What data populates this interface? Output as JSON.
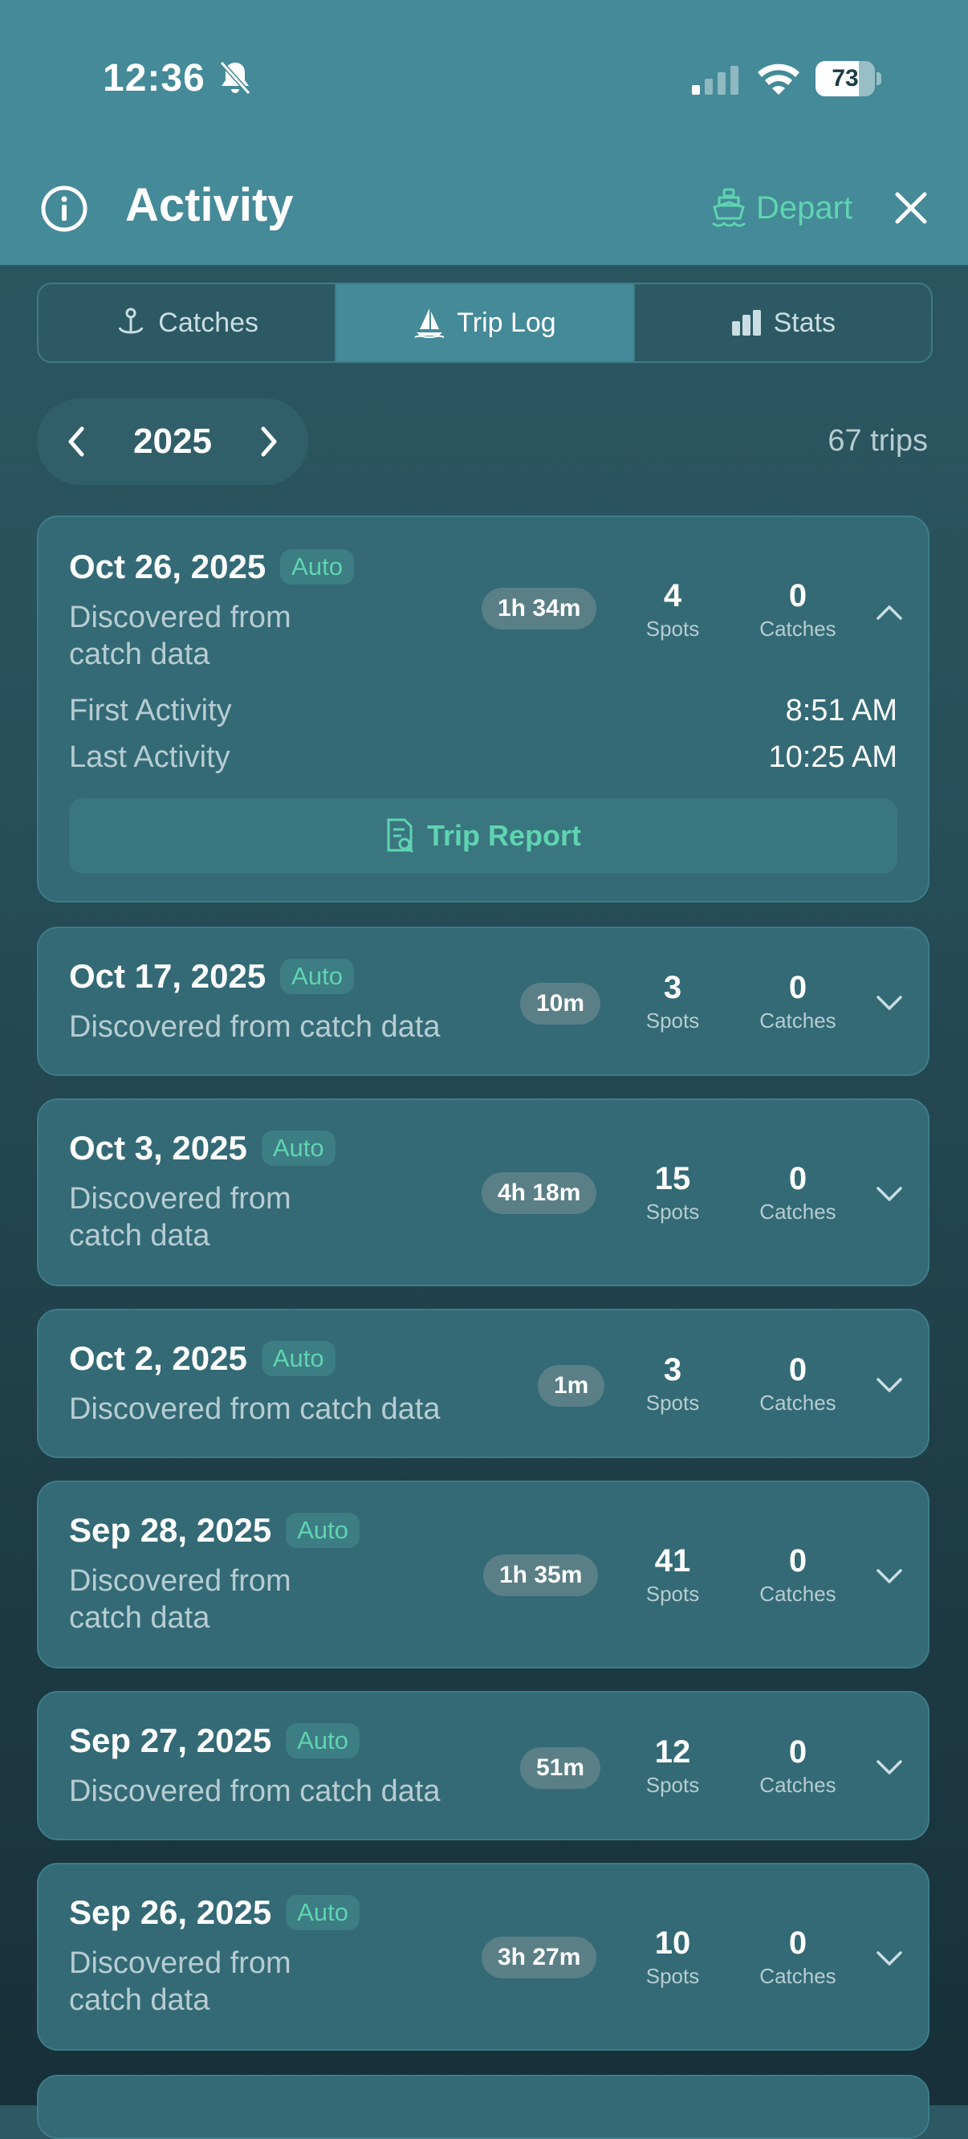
{
  "status_bar": {
    "time": "12:36",
    "battery": "73",
    "battery_level": 0.73
  },
  "header": {
    "title": "Activity",
    "depart_label": "Depart"
  },
  "tabs": [
    {
      "label": "Catches",
      "icon": "anchor-pin-icon"
    },
    {
      "label": "Trip Log",
      "icon": "sailboat-icon"
    },
    {
      "label": "Stats",
      "icon": "bar-chart-icon"
    }
  ],
  "active_tab": "Trip Log",
  "year_picker": {
    "year": "2025"
  },
  "trip_count": "67 trips",
  "labels": {
    "spots": "Spots",
    "catches": "Catches",
    "auto": "Auto"
  },
  "trips": [
    {
      "date": "Oct 26, 2025",
      "source_lines": [
        "Discovered from",
        "catch data"
      ],
      "duration": "1h 34m",
      "spots": "4",
      "catches": "0",
      "expanded": true,
      "details": {
        "first_label": "First Activity",
        "first_value": "8:51 AM",
        "last_label": "Last Activity",
        "last_value": "10:25 AM",
        "report_label": "Trip Report"
      }
    },
    {
      "date": "Oct 17, 2025",
      "source_lines": [
        "Discovered from catch data"
      ],
      "duration": "10m",
      "spots": "3",
      "catches": "0"
    },
    {
      "date": "Oct 3, 2025",
      "source_lines": [
        "Discovered from",
        "catch data"
      ],
      "duration": "4h 18m",
      "spots": "15",
      "catches": "0"
    },
    {
      "date": "Oct 2, 2025",
      "source_lines": [
        "Discovered from catch data"
      ],
      "duration": "1m",
      "spots": "3",
      "catches": "0"
    },
    {
      "date": "Sep 28, 2025",
      "source_lines": [
        "Discovered from",
        "catch data"
      ],
      "duration": "1h 35m",
      "spots": "41",
      "catches": "0"
    },
    {
      "date": "Sep 27, 2025",
      "source_lines": [
        "Discovered from catch data"
      ],
      "duration": "51m",
      "spots": "12",
      "catches": "0"
    },
    {
      "date": "Sep 26, 2025",
      "source_lines": [
        "Discovered from",
        "catch data"
      ],
      "duration": "3h 27m",
      "spots": "10",
      "catches": "0"
    }
  ],
  "colors": {
    "header": "#448a98",
    "accent": "#5fd4b0",
    "card": "#336a76"
  }
}
